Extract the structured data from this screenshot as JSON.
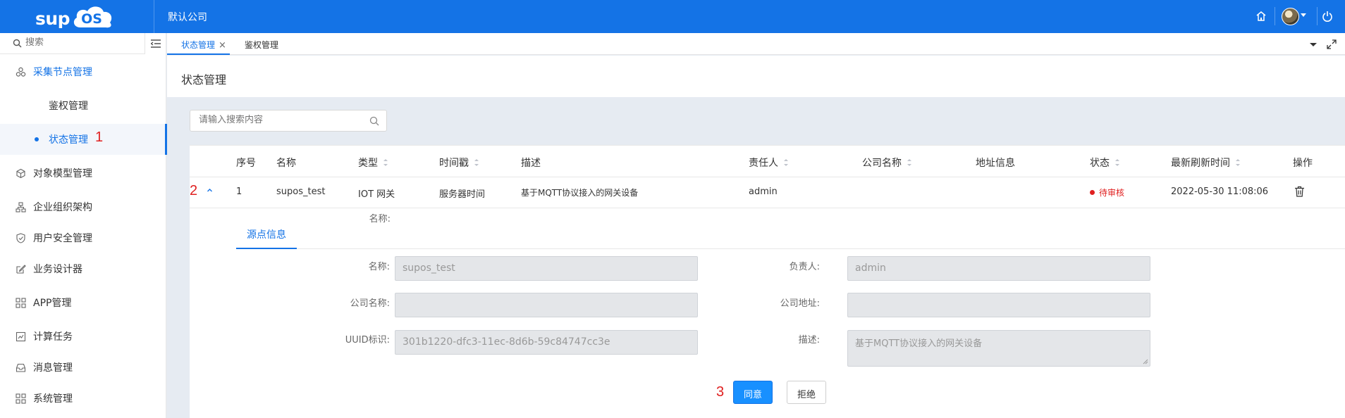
{
  "app": {
    "logo_text": "sup",
    "logo_badge": "OS",
    "company": "默认公司"
  },
  "icons": {
    "home": "home-icon",
    "power": "power-icon",
    "avatar": "user-avatar"
  },
  "sidebar": {
    "search_placeholder": "搜索",
    "items": [
      {
        "label": "采集节点管理",
        "icon": "nodes-icon"
      },
      {
        "label": "鉴权管理"
      },
      {
        "label": "状态管理"
      },
      {
        "label": "对象模型管理",
        "icon": "cube-icon"
      },
      {
        "label": "企业组织架构",
        "icon": "org-icon"
      },
      {
        "label": "用户安全管理",
        "icon": "shield-icon"
      },
      {
        "label": "业务设计器",
        "icon": "designer-icon"
      },
      {
        "label": "APP管理",
        "icon": "grid-icon"
      },
      {
        "label": "计算任务",
        "icon": "chart-icon"
      },
      {
        "label": "消息管理",
        "icon": "inbox-icon"
      },
      {
        "label": "系统管理",
        "icon": "grid-icon"
      }
    ]
  },
  "tabs": [
    {
      "label": "状态管理",
      "close": "×"
    },
    {
      "label": "鉴权管理"
    }
  ],
  "page": {
    "title": "状态管理",
    "search_placeholder": "请输入搜索内容"
  },
  "annotations": {
    "step1": "1",
    "step2": "2",
    "step3": "3"
  },
  "table": {
    "headers": [
      "序号",
      "名称",
      "类型",
      "时间戳",
      "描述",
      "责任人",
      "公司名称",
      "地址信息",
      "状态",
      "最新刷新时间",
      "操作"
    ],
    "row": {
      "index": "1",
      "name": "supos_test",
      "type": "IOT 网关",
      "timestamp": "服务器时间",
      "description": "基于MQTT协议接入的网关设备",
      "owner": "admin",
      "company": "",
      "address": "",
      "status": "待审核",
      "refreshed": "2022-05-30 11:08:06"
    }
  },
  "detail": {
    "tab": "源点信息",
    "fields": {
      "name_label": "名称:",
      "name_value": "supos_test",
      "owner_label": "负责人:",
      "owner_value": "admin",
      "company_label": "公司名称:",
      "company_value": "",
      "address_label": "公司地址:",
      "address_value": "",
      "uuid_label": "UUID标识:",
      "uuid_value": "301b1220-dfc3-11ec-8d6b-59c84747cc3e",
      "desc_label": "描述:",
      "desc_value": "基于MQTT协议接入的网关设备"
    },
    "approve": "同意",
    "reject": "拒绝"
  },
  "colors": {
    "brand": "#1473e6",
    "danger": "#e02020"
  }
}
